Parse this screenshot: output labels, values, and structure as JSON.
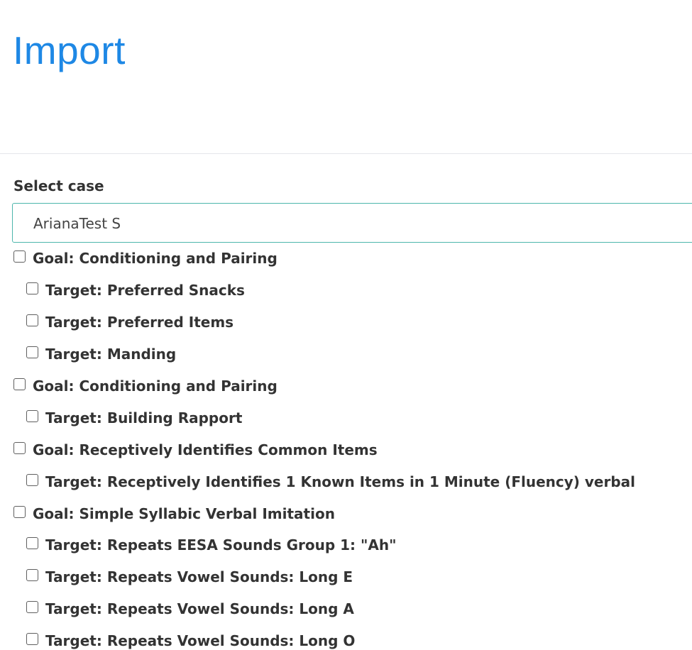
{
  "page": {
    "title": "Import"
  },
  "case_select": {
    "label": "Select case",
    "value": "ArianaTest S"
  },
  "items": [
    {
      "type": "goal",
      "label": "Goal: Conditioning and Pairing",
      "checked": false
    },
    {
      "type": "target",
      "label": "Target: Preferred Snacks",
      "checked": false
    },
    {
      "type": "target",
      "label": "Target: Preferred Items",
      "checked": false
    },
    {
      "type": "target",
      "label": "Target: Manding",
      "checked": false
    },
    {
      "type": "goal",
      "label": "Goal: Conditioning and Pairing",
      "checked": false
    },
    {
      "type": "target",
      "label": "Target: Building Rapport",
      "checked": false
    },
    {
      "type": "goal",
      "label": "Goal: Receptively Identifies Common Items",
      "checked": false
    },
    {
      "type": "target",
      "label": "Target: Receptively Identifies 1 Known Items in 1 Minute (Fluency) verbal",
      "checked": false
    },
    {
      "type": "goal",
      "label": "Goal: Simple Syllabic Verbal Imitation",
      "checked": false
    },
    {
      "type": "target",
      "label": "Target: Repeats EESA Sounds Group 1: \"Ah\"",
      "checked": false
    },
    {
      "type": "target",
      "label": "Target: Repeats Vowel Sounds: Long E",
      "checked": false
    },
    {
      "type": "target",
      "label": "Target: Repeats Vowel Sounds: Long A",
      "checked": false
    },
    {
      "type": "target",
      "label": "Target: Repeats Vowel Sounds: Long O",
      "checked": false
    }
  ]
}
